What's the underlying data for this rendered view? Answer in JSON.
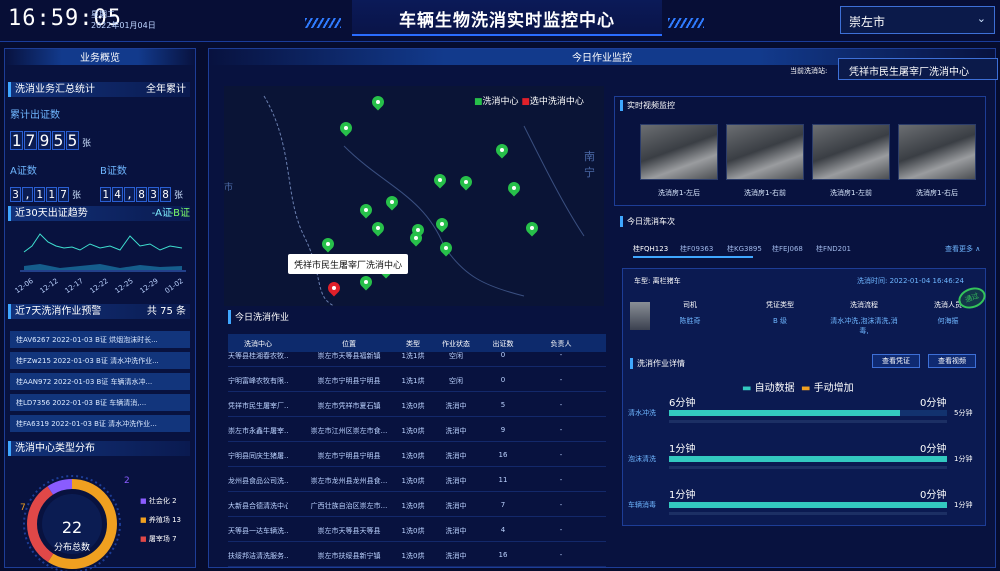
{
  "header": {
    "clock": "16:59:05",
    "weekday": "星期二",
    "date": "2022年01月04日",
    "title": "车辆生物洗消实时监控中心",
    "city": "崇左市"
  },
  "left": {
    "panel_title": "业务概览",
    "summary": {
      "title": "洗消业务汇总统计",
      "scope": "全年累计",
      "total_label": "累计出证数",
      "total_digits": [
        "1",
        "7",
        "9",
        "5",
        "5"
      ],
      "unit": "张",
      "a_label": "A证数",
      "a_digits": [
        "3",
        ",",
        "1",
        "1",
        "7"
      ],
      "b_label": "B证数",
      "b_digits": [
        "1",
        "4",
        ",",
        "8",
        "3",
        "8"
      ]
    },
    "trend": {
      "title": "近30天出证趋势",
      "legend_a": "-A证",
      "legend_b": "-B证",
      "ticks": [
        "12-06",
        "12-12",
        "12-17",
        "12-22",
        "12-25",
        "12-29",
        "01-02"
      ]
    },
    "warning": {
      "title": "近7天洗消作业预警",
      "count_label": "共 75 条",
      "items": [
        "桂AV6267 2022-01-03 B证 烘烟泡沫时长...",
        "桂FZw215 2022-01-03 B证 清水冲洗作业...",
        "桂AAN972 2022-01-03 B证 车辆清水冲...",
        "桂LD7356 2022-01-03 B证 车辆清消,...",
        "桂FA6319 2022-01-03 B证 清水冲洗作业..."
      ]
    },
    "distribution": {
      "title": "洗消中心类型分布",
      "total": "22",
      "total_label": "分布总数",
      "outer_left": "7",
      "outer_top": "2",
      "legend": [
        {
          "label": "社会化",
          "value": "2",
          "color": "#8a5cff"
        },
        {
          "label": "养殖场",
          "value": "13",
          "color": "#f0a020"
        },
        {
          "label": "屠宰场",
          "value": "7",
          "color": "#e04848"
        }
      ]
    }
  },
  "center": {
    "panel_title": "今日作业监控",
    "station_label": "当前洗消站:",
    "station_name": "凭祥市民生屠宰厂洗消中心",
    "map": {
      "legend_green": "洗消中心",
      "legend_red": "选中洗消中心",
      "popup": "凭祥市民生屠宰厂洗消中心",
      "place": "南宁",
      "place2": "市"
    },
    "jobs": {
      "title": "今日洗消作业",
      "headers": [
        "洗消中心",
        "位置",
        "类型",
        "作业状态",
        "出证数",
        "负责人"
      ],
      "rows": [
        [
          "天等县桂湘春农牧...",
          "崇左市天等县福新镇",
          "1洗1烘",
          "空闲",
          "0",
          "-"
        ],
        [
          "宁明富峰农牧有限...",
          "崇左市宁明县宁明县",
          "1洗1烘",
          "空闲",
          "0",
          "-"
        ],
        [
          "凭祥市民生屠宰厂...",
          "崇左市凭祥市夏石镇",
          "1洗0烘",
          "洗消中",
          "5",
          "-"
        ],
        [
          "崇左市永鑫牛屠宰...",
          "崇左市江州区崇左市食...",
          "1洗0烘",
          "洗消中",
          "9",
          "-"
        ],
        [
          "宁明县同庆生猪屠...",
          "崇左市宁明县宁明县",
          "1洗0烘",
          "洗消中",
          "16",
          "-"
        ],
        [
          "龙州县食品公司洗...",
          "崇左市龙州县龙州县食...",
          "1洗0烘",
          "洗消中",
          "11",
          "-"
        ],
        [
          "大新县合德清洗中心",
          "广西壮族自治区崇左市...",
          "1洗0烘",
          "洗消中",
          "7",
          "-"
        ],
        [
          "天等县一达车辆洗...",
          "崇左市天等县天等县",
          "1洗0烘",
          "洗消中",
          "4",
          "-"
        ],
        [
          "扶绥邦洁清洗服务...",
          "崇左市扶绥县新宁镇",
          "1洗0烘",
          "洗消中",
          "16",
          "-"
        ]
      ]
    }
  },
  "right": {
    "video": {
      "title": "实时视频监控",
      "cams": [
        "洗消房1-左后",
        "洗消房1-右前",
        "洗消房1-左前",
        "洗消房1-右后"
      ]
    },
    "vehicles": {
      "title": "今日洗消车次",
      "plates": [
        "桂FQH123",
        "桂F09363",
        "桂KG3895",
        "桂FEJ068",
        "桂FND201"
      ],
      "more": "查看更多 ∧",
      "car_type_label": "车型:",
      "car_type": "离栏猪车",
      "time_label": "洗消时间:",
      "time": "2022-01-04 16:46:24",
      "driver_label": "司机",
      "driver": "陈胜奇",
      "cert_label": "凭证类型",
      "cert": "B 级",
      "flow_label": "洗消流程",
      "flow": "清水冲洗,泡沫清洗,消毒,",
      "staff_label": "洗消人员",
      "staff": "何海振",
      "stamp": "通过",
      "detail_title": "洗消作业详情",
      "btn_cert": "查看凭证",
      "btn_video": "查看视频",
      "legend_auto": "自动数据",
      "legend_manual": "手动增加",
      "steps": [
        {
          "name": "清水冲洗",
          "left": "6分钟",
          "right": "0分钟",
          "value": "5分钟",
          "fraction": 0.83
        },
        {
          "name": "泡沫清洗",
          "left": "1分钟",
          "right": "0分钟",
          "value": "1分钟",
          "fraction": 1.0
        },
        {
          "name": "车辆消毒",
          "left": "1分钟",
          "right": "0分钟",
          "value": "1分钟",
          "fraction": 1.0
        }
      ]
    }
  }
}
